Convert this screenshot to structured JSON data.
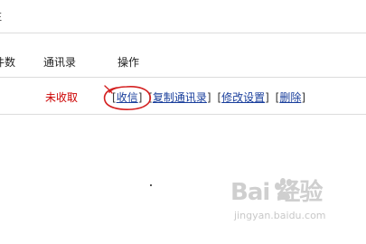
{
  "top_fragment": "注",
  "table": {
    "headers": {
      "count": "件数",
      "address_book": "通讯录",
      "actions": "操作"
    },
    "row": {
      "status": "未收取",
      "actions": [
        {
          "label": "收信"
        },
        {
          "label": "复制通讯录"
        },
        {
          "label": "修改设置"
        },
        {
          "label": "删除"
        }
      ]
    }
  },
  "annotation": {
    "type": "hand-drawn circle",
    "color": "#d42020",
    "target": "收信"
  },
  "watermark": {
    "brand": "Bai 经验",
    "url": "jingyan.baidu.com"
  }
}
